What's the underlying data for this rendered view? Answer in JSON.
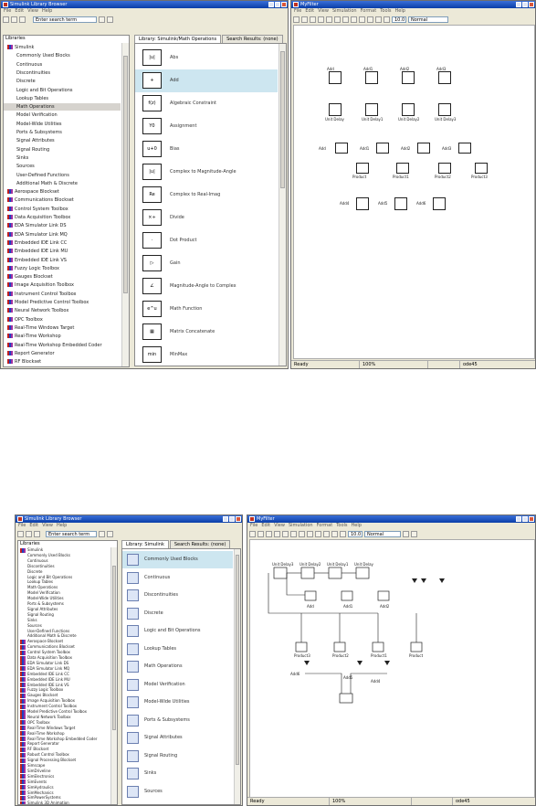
{
  "top": {
    "library": {
      "title": "Simulink Library Browser",
      "menu": [
        "File",
        "Edit",
        "View",
        "Help"
      ],
      "find_value": "Enter search term",
      "tree_header": "Libraries",
      "tree": [
        {
          "label": "Simulink",
          "level": 0,
          "colored": true
        },
        {
          "label": "Commonly Used Blocks",
          "level": 1
        },
        {
          "label": "Continuous",
          "level": 1
        },
        {
          "label": "Discontinuities",
          "level": 1
        },
        {
          "label": "Discrete",
          "level": 1
        },
        {
          "label": "Logic and Bit Operations",
          "level": 1
        },
        {
          "label": "Lookup Tables",
          "level": 1
        },
        {
          "label": "Math Operations",
          "level": 1,
          "selected": true
        },
        {
          "label": "Model Verification",
          "level": 1
        },
        {
          "label": "Model-Wide Utilities",
          "level": 1
        },
        {
          "label": "Ports & Subsystems",
          "level": 1
        },
        {
          "label": "Signal Attributes",
          "level": 1
        },
        {
          "label": "Signal Routing",
          "level": 1
        },
        {
          "label": "Sinks",
          "level": 1
        },
        {
          "label": "Sources",
          "level": 1
        },
        {
          "label": "User-Defined Functions",
          "level": 1
        },
        {
          "label": "Additional Math & Discrete",
          "level": 1
        },
        {
          "label": "Aerospace Blockset",
          "level": 0,
          "colored": true
        },
        {
          "label": "Communications Blockset",
          "level": 0,
          "colored": true
        },
        {
          "label": "Control System Toolbox",
          "level": 0,
          "colored": true
        },
        {
          "label": "Data Acquisition Toolbox",
          "level": 0,
          "colored": true
        },
        {
          "label": "EDA Simulator Link DS",
          "level": 0,
          "colored": true
        },
        {
          "label": "EDA Simulator Link MQ",
          "level": 0,
          "colored": true
        },
        {
          "label": "Embedded IDE Link CC",
          "level": 0,
          "colored": true
        },
        {
          "label": "Embedded IDE Link MU",
          "level": 0,
          "colored": true
        },
        {
          "label": "Embedded IDE Link VS",
          "level": 0,
          "colored": true
        },
        {
          "label": "Fuzzy Logic Toolbox",
          "level": 0,
          "colored": true
        },
        {
          "label": "Gauges Blockset",
          "level": 0,
          "colored": true
        },
        {
          "label": "Image Acquisition Toolbox",
          "level": 0,
          "colored": true
        },
        {
          "label": "Instrument Control Toolbox",
          "level": 0,
          "colored": true
        },
        {
          "label": "Model Predictive Control Toolbox",
          "level": 0,
          "colored": true
        },
        {
          "label": "Neural Network Toolbox",
          "level": 0,
          "colored": true
        },
        {
          "label": "OPC Toolbox",
          "level": 0,
          "colored": true
        },
        {
          "label": "Real-Time Windows Target",
          "level": 0,
          "colored": true
        },
        {
          "label": "Real-Time Workshop",
          "level": 0,
          "colored": true
        },
        {
          "label": "Real-Time Workshop Embedded Coder",
          "level": 0,
          "colored": true
        },
        {
          "label": "Report Generator",
          "level": 0,
          "colored": true
        },
        {
          "label": "RF Blockset",
          "level": 0,
          "colored": true
        }
      ],
      "tabs": [
        "Library: Simulink/Math Operations",
        "Search Results: (none)"
      ],
      "blocks": [
        {
          "label": "Abs",
          "icon": "|u|"
        },
        {
          "label": "Add",
          "icon": "+",
          "selected": true
        },
        {
          "label": "Algebraic Constraint",
          "icon": "f(z)"
        },
        {
          "label": "Assignment",
          "icon": "Y0"
        },
        {
          "label": "Bias",
          "icon": "u+0"
        },
        {
          "label": "Complex to Magnitude-Angle",
          "icon": "|u|"
        },
        {
          "label": "Complex to Real-Imag",
          "icon": "Re"
        },
        {
          "label": "Divide",
          "icon": "×÷"
        },
        {
          "label": "Dot Product",
          "icon": "·"
        },
        {
          "label": "Gain",
          "icon": "▷"
        },
        {
          "label": "Magnitude-Angle to Complex",
          "icon": "∠"
        },
        {
          "label": "Math Function",
          "icon": "e^u"
        },
        {
          "label": "Matrix Concatenate",
          "icon": "▦"
        },
        {
          "label": "MinMax",
          "icon": "min"
        }
      ]
    },
    "model": {
      "title": "MyFilter",
      "menu": [
        "File",
        "Edit",
        "View",
        "Simulation",
        "Format",
        "Tools",
        "Help"
      ],
      "stop_time": "10.0",
      "mode": "Normal",
      "blocks_row1": [
        "Add",
        "Add1",
        "Add2",
        "Add3"
      ],
      "blocks_row2": [
        "Unit Delay",
        "Unit Delay1",
        "Unit Delay2",
        "Unit Delay3"
      ],
      "blocks_row3": [
        "Add",
        "Add1",
        "Add2",
        "Add3"
      ],
      "blocks_row4": [
        "Product",
        "Product1",
        "Product2",
        "Product3"
      ],
      "blocks_row5": [
        "Add4",
        "Add5",
        "Add6"
      ],
      "status": [
        "Ready",
        "100%",
        "",
        "ode45"
      ]
    }
  },
  "bottom": {
    "library": {
      "title": "Simulink Library Browser",
      "menu": [
        "File",
        "Edit",
        "View",
        "Help"
      ],
      "find_value": "Enter search term",
      "tree_header": "Libraries",
      "tabs": [
        "Library: Simulink",
        "Search Results: (none)"
      ],
      "tree": [
        "Simulink",
        "Commonly Used Blocks",
        "Continuous",
        "Discontinuities",
        "Discrete",
        "Logic and Bit Operations",
        "Lookup Tables",
        "Math Operations",
        "Model Verification",
        "Model-Wide Utilities",
        "Ports & Subsystems",
        "Signal Attributes",
        "Signal Routing",
        "Sinks",
        "Sources",
        "User-Defined Functions",
        "Additional Math & Discrete",
        "Aerospace Blockset",
        "Communications Blockset",
        "Control System Toolbox",
        "Data Acquisition Toolbox",
        "EDA Simulator Link DS",
        "EDA Simulator Link MQ",
        "Embedded IDE Link CC",
        "Embedded IDE Link MU",
        "Embedded IDE Link VS",
        "Fuzzy Logic Toolbox",
        "Gauges Blockset",
        "Image Acquisition Toolbox",
        "Instrument Control Toolbox",
        "Model Predictive Control Toolbox",
        "Neural Network Toolbox",
        "OPC Toolbox",
        "Real-Time Windows Target",
        "Real-Time Workshop",
        "Real-Time Workshop Embedded Coder",
        "Report Generator",
        "RF Blockset",
        "Robust Control Toolbox",
        "Signal Processing Blockset",
        "Simscape",
        "SimDriveline",
        "SimElectronics",
        "SimEvents",
        "SimHydraulics",
        "SimMechanics",
        "SimPowerSystems",
        "Simulink 3D Animation"
      ],
      "blocks": [
        "Commonly Used Blocks",
        "Continuous",
        "Discontinuities",
        "Discrete",
        "Logic and Bit Operations",
        "Lookup Tables",
        "Math Operations",
        "Model Verification",
        "Model-Wide Utilities",
        "Ports & Subsystems",
        "Signal Attributes",
        "Signal Routing",
        "Sinks",
        "Sources"
      ]
    },
    "model": {
      "title": "MyFilter",
      "menu": [
        "File",
        "Edit",
        "View",
        "Simulation",
        "Format",
        "Tools",
        "Help"
      ],
      "stop_time": "10.0",
      "mode": "Normal",
      "delays": [
        "Unit Delay3",
        "Unit Delay2",
        "Unit Delay1",
        "Unit Delay"
      ],
      "products": [
        "Product3",
        "Product2",
        "Product1",
        "Product"
      ],
      "adds": [
        "Add",
        "Add1",
        "Add2"
      ],
      "out_labels": [
        "Add6",
        "Add5",
        "Add4"
      ],
      "status": [
        "Ready",
        "100%",
        "",
        "ode45"
      ]
    }
  },
  "colors": {
    "title_bar": "#0a3ea8",
    "selection": "#cde6f0",
    "chrome": "#ece9d8"
  }
}
